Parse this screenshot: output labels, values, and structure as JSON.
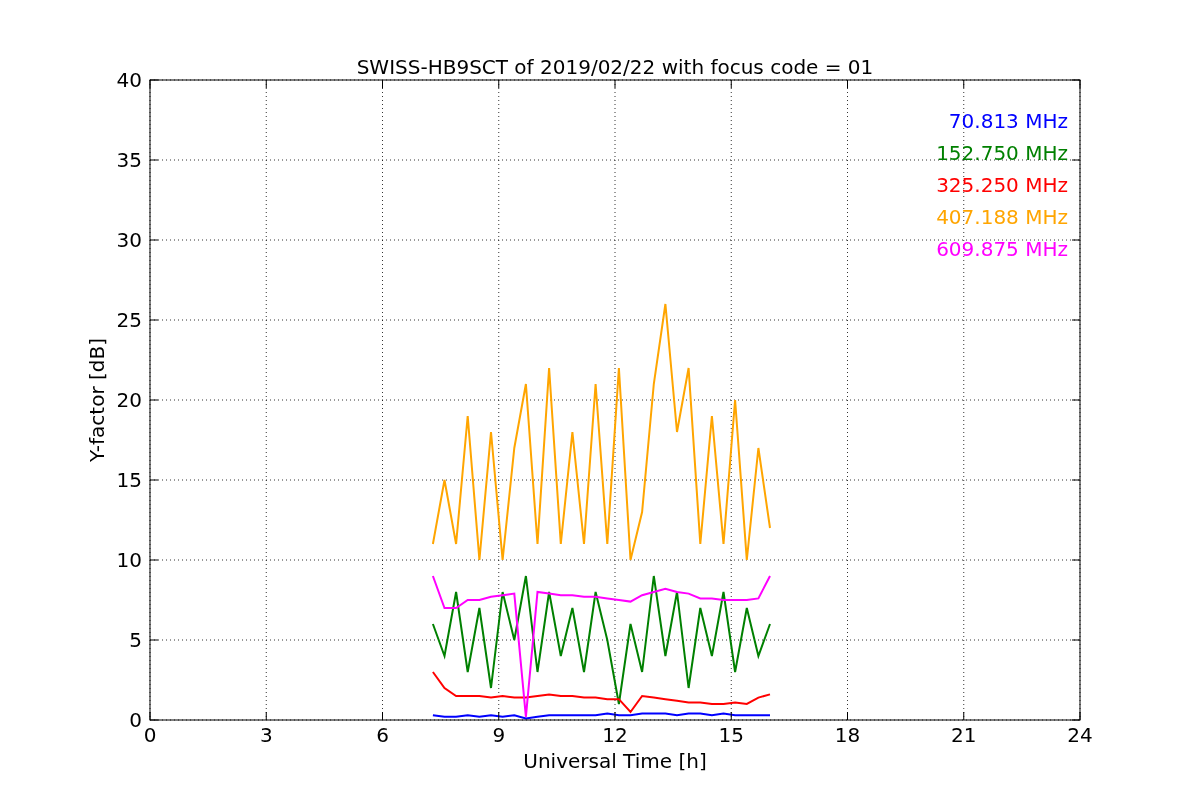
{
  "chart_data": {
    "type": "line",
    "title": "SWISS-HB9SCT of 2019/02/22 with focus code = 01",
    "xlabel": "Universal Time [h]",
    "ylabel": "Y-factor [dB]",
    "x": [
      7.3,
      7.6,
      7.9,
      8.2,
      8.5,
      8.8,
      9.1,
      9.4,
      9.7,
      10.0,
      10.3,
      10.6,
      10.9,
      11.2,
      11.5,
      11.8,
      12.1,
      12.4,
      12.7,
      13.0,
      13.3,
      13.6,
      13.9,
      14.2,
      14.5,
      14.8,
      15.1,
      15.4,
      15.7,
      16.0
    ],
    "grid": true,
    "xlim": [
      0,
      24
    ],
    "ylim": [
      0,
      40
    ],
    "xticks": [
      0,
      3,
      6,
      9,
      12,
      15,
      18,
      21,
      24
    ],
    "yticks": [
      0,
      5,
      10,
      15,
      20,
      25,
      30,
      35,
      40
    ],
    "series": [
      {
        "name": "70.813 MHz",
        "color": "#0000ff",
        "values": [
          0.3,
          0.2,
          0.2,
          0.3,
          0.2,
          0.3,
          0.2,
          0.3,
          0.1,
          0.2,
          0.3,
          0.3,
          0.3,
          0.3,
          0.3,
          0.4,
          0.3,
          0.3,
          0.4,
          0.4,
          0.4,
          0.3,
          0.4,
          0.4,
          0.3,
          0.4,
          0.3,
          0.3,
          0.3,
          0.3
        ]
      },
      {
        "name": "152.750 MHz",
        "color": "#008000",
        "values": [
          6,
          4,
          8,
          3,
          7,
          2,
          8,
          5,
          9,
          3,
          8,
          4,
          7,
          3,
          8,
          5,
          1,
          6,
          3,
          9,
          4,
          8,
          2,
          7,
          4,
          8,
          3,
          7,
          4,
          6
        ]
      },
      {
        "name": "325.250 MHz",
        "color": "#ff0000",
        "values": [
          3,
          2,
          1.5,
          1.5,
          1.5,
          1.4,
          1.5,
          1.4,
          1.4,
          1.5,
          1.6,
          1.5,
          1.5,
          1.4,
          1.4,
          1.3,
          1.3,
          0.5,
          1.5,
          1.4,
          1.3,
          1.2,
          1.1,
          1.1,
          1.0,
          1.0,
          1.1,
          1.0,
          1.4,
          1.6
        ]
      },
      {
        "name": "407.188 MHz",
        "color": "#ffa500",
        "values": [
          11,
          15,
          11,
          19,
          10,
          18,
          10,
          17,
          21,
          11,
          22,
          11,
          18,
          11,
          21,
          11,
          22,
          10,
          13,
          21,
          26,
          18,
          22,
          11,
          19,
          11,
          20,
          10,
          17,
          12
        ]
      },
      {
        "name": "609.875 MHz",
        "color": "#ff00ff",
        "values": [
          9,
          7,
          7,
          7.5,
          7.5,
          7.7,
          7.8,
          7.9,
          0.2,
          8,
          7.9,
          7.8,
          7.8,
          7.7,
          7.7,
          7.6,
          7.5,
          7.4,
          7.8,
          8,
          8.2,
          8,
          7.9,
          7.6,
          7.6,
          7.5,
          7.5,
          7.5,
          7.6,
          9
        ]
      }
    ]
  }
}
